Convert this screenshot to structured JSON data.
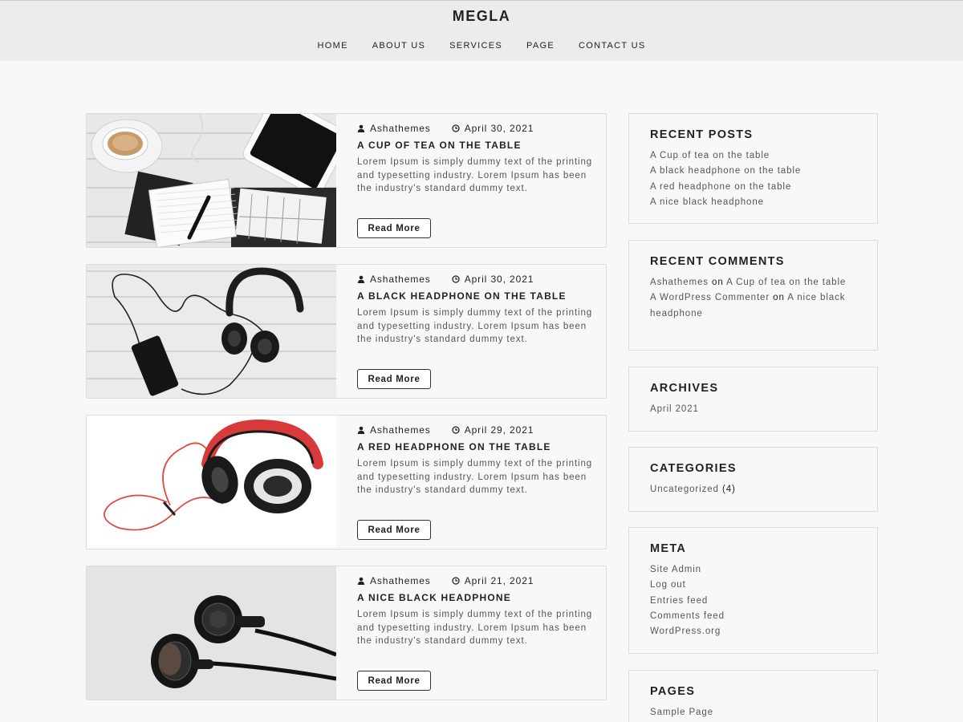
{
  "site": {
    "title": "MEGLA"
  },
  "nav": [
    "HOME",
    "ABOUT US",
    "SERVICES",
    "PAGE",
    "CONTACT US"
  ],
  "posts": [
    {
      "author": "Ashathemes",
      "date": "April 30, 2021",
      "title": "A CUP OF TEA ON THE TABLE",
      "excerpt": "Lorem Ipsum is simply dummy text of the printing and typesetting industry. Lorem Ipsum has been the industry's standard dummy text.",
      "button": "Read More"
    },
    {
      "author": "Ashathemes",
      "date": "April 30, 2021",
      "title": "A BLACK HEADPHONE ON THE TABLE",
      "excerpt": "Lorem Ipsum is simply dummy text of the printing and typesetting industry. Lorem Ipsum has been the industry's standard dummy text.",
      "button": "Read More"
    },
    {
      "author": "Ashathemes",
      "date": "April 29, 2021",
      "title": "A RED HEADPHONE ON THE TABLE",
      "excerpt": "Lorem Ipsum is simply dummy text of the printing and typesetting industry. Lorem Ipsum has been the industry's standard dummy text.",
      "button": "Read More"
    },
    {
      "author": "Ashathemes",
      "date": "April 21, 2021",
      "title": "A NICE BLACK HEADPHONE",
      "excerpt": "Lorem Ipsum is simply dummy text of the printing and typesetting industry. Lorem Ipsum has been the industry's standard dummy text.",
      "button": "Read More"
    }
  ],
  "sidebar": {
    "recent_posts": {
      "title": "RECENT POSTS",
      "items": [
        "A Cup of tea on the table",
        "A black headphone on the table",
        "A red headphone on the table",
        "A nice black headphone"
      ]
    },
    "recent_comments": {
      "title": "RECENT COMMENTS",
      "items": [
        {
          "author": "Ashathemes",
          "on": "on",
          "post": "A Cup of tea on the table"
        },
        {
          "author": "A WordPress Commenter",
          "on": "on",
          "post": "A nice black headphone"
        }
      ]
    },
    "archives": {
      "title": "ARCHIVES",
      "items": [
        "April 2021"
      ]
    },
    "categories": {
      "title": "CATEGORIES",
      "items": [
        {
          "name": "Uncategorized",
          "count": "(4)"
        }
      ]
    },
    "meta": {
      "title": "META",
      "items": [
        "Site Admin",
        "Log out",
        "Entries feed",
        "Comments feed",
        "WordPress.org"
      ]
    },
    "pages": {
      "title": "PAGES",
      "items": [
        "Sample Page"
      ]
    }
  },
  "icons": {
    "author": "user-icon",
    "date": "clock-icon"
  },
  "colors": {
    "background": "#f7f8fa",
    "header": "#ececec",
    "text": "#222222",
    "muted": "#555555",
    "accent_red": "#d63a3a"
  }
}
